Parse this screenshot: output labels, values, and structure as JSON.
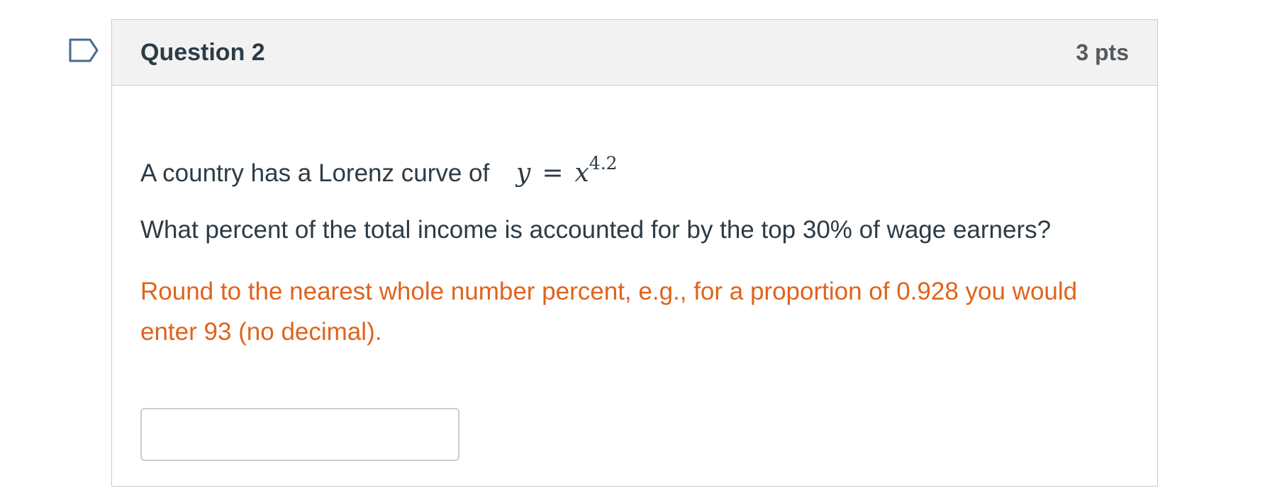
{
  "question": {
    "title": "Question 2",
    "points": "3 pts",
    "line1_text": "A country has a Lorenz curve of",
    "math": {
      "lhs": "y",
      "equals": "=",
      "base": "x",
      "exponent": "4.2"
    },
    "line2_text": "What percent of the total income is accounted for by the top 30% of wage earners?",
    "instruction": "Round to the nearest whole number percent, e.g., for a proportion of 0.928 you would enter 93 (no decimal).",
    "answer": {
      "value": "",
      "placeholder": ""
    }
  },
  "icons": {
    "flag": "bookmark-flag-icon"
  },
  "colors": {
    "instruction": "#e0631c",
    "header_bg": "#f2f2f2",
    "border": "#c7cdd1",
    "text": "#2d3b45",
    "flag": "#4a6a8a"
  }
}
